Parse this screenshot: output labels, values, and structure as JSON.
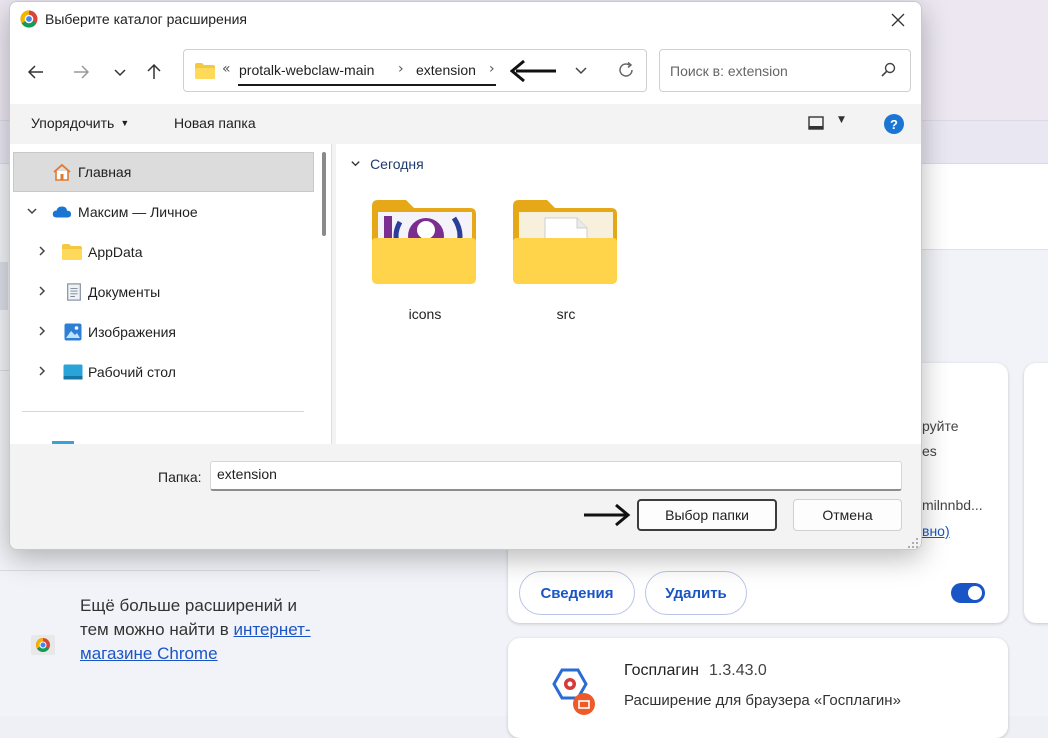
{
  "dialog": {
    "title": "Выберите каталог расширения",
    "address": {
      "overflow": "«",
      "crumbs": [
        "protalk-webclaw-main",
        "extension"
      ]
    },
    "search_placeholder": "Поиск в: extension",
    "toolbar": {
      "organize": "Упорядочить",
      "new_folder": "Новая папка"
    },
    "nav_tree": [
      {
        "label": "Главная"
      },
      {
        "label": "Максим — Личное"
      },
      {
        "label": "AppData"
      },
      {
        "label": "Документы"
      },
      {
        "label": "Изображения"
      },
      {
        "label": "Рабочий стол"
      }
    ],
    "group_header": "Сегодня",
    "folders": [
      {
        "name": "icons"
      },
      {
        "name": "src"
      }
    ],
    "folder_label": "Папка:",
    "folder_value": "extension",
    "select_button": "Выбор папки",
    "cancel_button": "Отмена",
    "help": "?"
  },
  "background": {
    "card_text_fragments": [
      "руйте",
      "es",
      "milnnbd...",
      "вно)"
    ],
    "details_button": "Сведения",
    "remove_button": "Удалить",
    "more_text_1": "Ещё больше расширений и тем можно найти в",
    "more_link": "интернет-магазине Chrome",
    "extension_name": "Госплагин",
    "extension_version": "1.3.43.0",
    "extension_desc": "Расширение для браузера «Госплагин»"
  },
  "colors": {
    "accent": "#1a55c8",
    "help_blue": "#1b76d3",
    "folder_yellow": "#f5c842"
  }
}
